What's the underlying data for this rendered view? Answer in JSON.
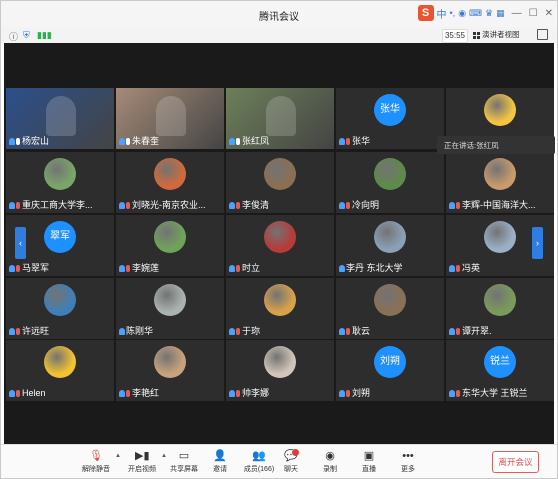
{
  "window": {
    "title": "腾讯会议"
  },
  "system_tray": {
    "ime_label": "中",
    "icons": [
      "sogou-ime-icon",
      "punctuation-icon",
      "mic-icon",
      "keyboard-icon",
      "skin-icon",
      "tools-icon"
    ]
  },
  "infobar": {
    "timer": "35:55",
    "view_mode": "演讲者视图"
  },
  "speaking": {
    "label": "正在讲话:",
    "name": "张红凤"
  },
  "participants": [
    {
      "name": "杨宏山",
      "type": "video",
      "avatar_color": "#2b4f8c",
      "badge": "mic"
    },
    {
      "name": "朱春奎",
      "type": "video",
      "avatar_color": "#a58b78",
      "badge": "mic"
    },
    {
      "name": "张红凤",
      "type": "video",
      "avatar_color": "#6d7f5a",
      "badge": "mic"
    },
    {
      "name": "张华",
      "type": "name",
      "avatar_text": "张华",
      "avatar_color": "#1e90ff",
      "badge": "muted"
    },
    {
      "name": "",
      "type": "avatar",
      "avatar_color": "#f4c542",
      "badge": ""
    },
    {
      "name": "重庆工商大学李...",
      "type": "avatar",
      "avatar_color": "#7aa56a",
      "badge": "muted"
    },
    {
      "name": "刘晓光-南京农业...",
      "type": "avatar",
      "avatar_color": "#d2693b",
      "badge": "muted"
    },
    {
      "name": "李俊清",
      "type": "avatar",
      "avatar_color": "#8b6f52",
      "badge": "muted"
    },
    {
      "name": "冷向明",
      "type": "avatar",
      "avatar_color": "#5e8a4a",
      "badge": "muted"
    },
    {
      "name": "李辉-中国海洋大...",
      "type": "avatar",
      "avatar_color": "#c79b6b",
      "badge": "muted"
    },
    {
      "name": "马翠军",
      "type": "name",
      "avatar_text": "翠军",
      "avatar_color": "#1e90ff",
      "badge": "muted"
    },
    {
      "name": "李婉莲",
      "type": "avatar",
      "avatar_color": "#6fa35a",
      "badge": "muted"
    },
    {
      "name": "时立",
      "type": "avatar",
      "avatar_color": "#b83a3a",
      "badge": "muted"
    },
    {
      "name": "李丹 东北大学",
      "type": "avatar",
      "avatar_color": "#8aa0b8",
      "badge": ""
    },
    {
      "name": "冯英",
      "type": "avatar",
      "avatar_color": "#9ab0c8",
      "badge": "muted"
    },
    {
      "name": "许远旺",
      "type": "avatar",
      "avatar_color": "#3f7fb8",
      "badge": "muted"
    },
    {
      "name": "陈刚华",
      "type": "avatar",
      "avatar_color": "#aab3b0",
      "badge": ""
    },
    {
      "name": "于珎",
      "type": "avatar",
      "avatar_color": "#d8a24a",
      "badge": "muted"
    },
    {
      "name": "耿云",
      "type": "avatar",
      "avatar_color": "#8a7055",
      "badge": "muted"
    },
    {
      "name": "谭开翠.",
      "type": "avatar",
      "avatar_color": "#7a9b5a",
      "badge": "muted"
    },
    {
      "name": "Helen",
      "type": "avatar",
      "avatar_color": "#f2c230",
      "badge": "muted"
    },
    {
      "name": "李艳红",
      "type": "avatar",
      "avatar_color": "#c9a27a",
      "badge": "muted"
    },
    {
      "name": "帅李娜",
      "type": "avatar",
      "avatar_color": "#d0c5b8",
      "badge": "muted"
    },
    {
      "name": "刘朔",
      "type": "name",
      "avatar_text": "刘朔",
      "avatar_color": "#1e90ff",
      "badge": "muted"
    },
    {
      "name": "东华大学 王锐兰",
      "type": "name",
      "avatar_text": "锐兰",
      "avatar_color": "#1e90ff",
      "badge": "muted"
    }
  ],
  "toolbar": {
    "unmute": "解除静音",
    "start_video": "开启视频",
    "share_screen": "共享屏幕",
    "invite": "邀请",
    "members": "成员(166)",
    "chat": "聊天",
    "record": "录制",
    "live": "直播",
    "more": "更多",
    "leave": "离开会议"
  },
  "colors": {
    "accent": "#1e90ff",
    "leave": "#e04b4b",
    "stage_bg": "#1a1a1a",
    "tile_bg": "#2d2d2d"
  }
}
